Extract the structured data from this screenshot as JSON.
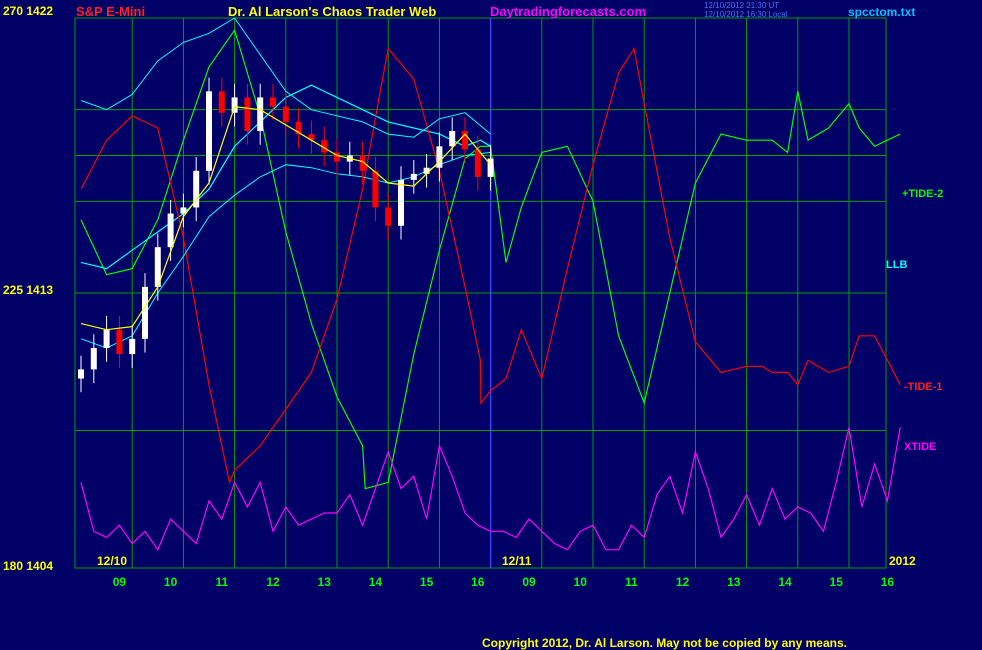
{
  "header": {
    "top_price_label": "270  1422",
    "instrument": "S&P E-Mini",
    "title": "Dr. Al Larson's Chaos Trader Web",
    "site": "Daytradingforecasts.com",
    "timestamp_line1": "12/10/2012 21:30 UT",
    "timestamp_line2": "12/10/2012 16:30 Local",
    "filename": "spcctom.txt"
  },
  "footer": {
    "copyright": "Copyright 2012, Dr. Al Larson. May not be copied by any means."
  },
  "colors": {
    "background": "#000066",
    "grid": "#00a000",
    "divider": "#4040ff",
    "axis_text": "#ffff00",
    "tick_text": "#00ff00",
    "title": "#ffff00",
    "instrument": "#ff2020",
    "site": "#ff00ff",
    "filename": "#00c0ff",
    "tide2": "#00ff00",
    "llb": "#00ffff",
    "tide1": "#ff0000",
    "xtide": "#ff00ff",
    "candle_up": "#ffffff",
    "candle_down": "#ff0000",
    "moving_average": "#ffff00"
  },
  "chart_data": {
    "type": "line",
    "title": "Dr. Al Larson's Chaos Trader Web",
    "y_axis_labels": [
      "270  1422",
      "225  1413",
      "180  1404"
    ],
    "ylim_price": [
      1404,
      1422
    ],
    "ylim_cycle": [
      180,
      270
    ],
    "date_labels": [
      "12/10",
      "12/11",
      "2012"
    ],
    "x_ticks": [
      "09",
      "10",
      "11",
      "12",
      "13",
      "14",
      "15",
      "16",
      "09",
      "10",
      "11",
      "12",
      "13",
      "14",
      "15",
      "16"
    ],
    "x_range": [
      0,
      16
    ],
    "grid": true,
    "legend_placement": "right",
    "price_bars": {
      "label": "S&P E-Mini",
      "x": [
        0.0,
        0.25,
        0.5,
        0.75,
        1.0,
        1.25,
        1.5,
        1.75,
        2.0,
        2.25,
        2.5,
        2.75,
        3.0,
        3.25,
        3.5,
        3.75,
        4.0,
        4.25,
        4.5,
        4.75,
        5.0,
        5.25,
        5.5,
        5.75,
        6.0,
        6.25,
        6.5,
        6.75,
        7.0,
        7.25,
        7.5,
        7.75,
        8.0
      ],
      "close": [
        1410.5,
        1411.2,
        1411.8,
        1411.0,
        1411.5,
        1413.2,
        1414.5,
        1415.6,
        1415.8,
        1417.0,
        1419.6,
        1418.9,
        1419.4,
        1418.3,
        1419.4,
        1419.1,
        1418.6,
        1418.2,
        1418.0,
        1417.6,
        1417.3,
        1417.5,
        1417.0,
        1415.8,
        1415.2,
        1416.7,
        1416.9,
        1417.1,
        1417.8,
        1418.3,
        1417.7,
        1416.8,
        1417.4
      ]
    },
    "moving_average": {
      "x": [
        0,
        0.5,
        1,
        1.5,
        2,
        2.5,
        3,
        3.5,
        4,
        4.5,
        5,
        5.5,
        6,
        6.5,
        7,
        7.5,
        8
      ],
      "y": [
        1412.0,
        1411.8,
        1411.9,
        1413.2,
        1415.5,
        1416.6,
        1419.1,
        1419.0,
        1418.5,
        1418.0,
        1417.5,
        1417.3,
        1416.6,
        1416.5,
        1417.3,
        1418.2,
        1417.2
      ]
    },
    "envelope": {
      "upper_x": [
        0,
        0.5,
        1,
        1.5,
        2,
        2.5,
        3,
        3.5,
        4,
        4.5,
        5,
        5.5,
        6,
        6.5,
        7,
        7.5,
        8
      ],
      "upper_y": [
        1419.3,
        1419.0,
        1419.5,
        1420.6,
        1421.2,
        1421.5,
        1422.0,
        1420.8,
        1419.6,
        1419.0,
        1418.8,
        1418.6,
        1418.2,
        1418.1,
        1418.7,
        1418.9,
        1418.2
      ],
      "lower_x": [
        0,
        0.5,
        1,
        1.5,
        2,
        2.5,
        3,
        3.5,
        4,
        4.5,
        5,
        5.5,
        6,
        6.5,
        7,
        7.5,
        8
      ],
      "lower_y": [
        1411.5,
        1411.2,
        1411.6,
        1413.0,
        1414.2,
        1415.5,
        1416.2,
        1416.8,
        1417.2,
        1417.1,
        1416.9,
        1416.8,
        1416.6,
        1416.8,
        1417.2,
        1417.5,
        1417.6
      ]
    },
    "series": [
      {
        "name": "+TIDE-2",
        "x": [
          0,
          0.5,
          1,
          1.5,
          2,
          2.5,
          3,
          3.5,
          4,
          4.5,
          5,
          5.5,
          5.55,
          6,
          6.5,
          7,
          7.5,
          7.8,
          8,
          8.3,
          8.6,
          9,
          9.5,
          10,
          10.5,
          11,
          11.5,
          12,
          12.5,
          13,
          13.5,
          13.8,
          14,
          14.2,
          14.6,
          15,
          15.2,
          15.5,
          16
        ],
        "y": [
          237,
          228,
          229,
          237,
          250,
          262,
          268,
          254,
          235,
          220,
          208,
          200,
          193,
          194,
          215,
          232,
          247,
          249,
          249,
          230,
          239,
          248,
          249,
          240,
          218,
          207,
          225,
          243,
          251,
          250,
          250,
          248,
          258,
          250,
          252,
          256,
          252,
          249,
          251
        ]
      },
      {
        "name": "LLB",
        "x": [
          0,
          0.5,
          1,
          1.5,
          2,
          2.5,
          3,
          3.5,
          4,
          4.5,
          5,
          5.5,
          6,
          6.5,
          7,
          7.5,
          7.8,
          8
        ],
        "y": [
          230,
          229,
          232,
          235,
          238,
          242,
          249,
          253,
          257,
          259,
          257,
          255,
          253,
          252,
          251,
          249,
          250,
          249
        ]
      },
      {
        "name": "-TIDE-1",
        "x": [
          0,
          0.5,
          1,
          1.5,
          2,
          2.5,
          2.9,
          3.0,
          3.5,
          4,
          4.5,
          5,
          5.5,
          5.8,
          6,
          6.5,
          7,
          7.5,
          7.8,
          7.81,
          8,
          8.3,
          8.6,
          9,
          9.5,
          10,
          10.5,
          10.8,
          11,
          11.5,
          12,
          12.5,
          13,
          13.3,
          13.5,
          13.8,
          14,
          14.2,
          14.6,
          15,
          15.2,
          15.5,
          16
        ],
        "y": [
          242,
          250,
          254,
          252,
          234,
          210,
          194,
          196,
          200,
          206,
          212,
          224,
          242,
          256,
          265,
          260,
          245,
          226,
          214,
          207,
          209,
          211,
          219,
          211,
          229,
          246,
          261,
          265,
          256,
          234,
          217,
          212,
          213,
          213,
          212,
          212,
          210,
          214,
          212,
          213,
          218,
          218,
          210
        ]
      },
      {
        "name": "XTIDE",
        "x": [
          0,
          0.25,
          0.5,
          0.75,
          1,
          1.25,
          1.5,
          1.75,
          2,
          2.25,
          2.5,
          2.75,
          3,
          3.25,
          3.5,
          3.75,
          4,
          4.25,
          4.5,
          4.75,
          5,
          5.25,
          5.5,
          5.75,
          6,
          6.25,
          6.5,
          6.75,
          7,
          7.25,
          7.5,
          7.75,
          8,
          8.25,
          8.5,
          8.75,
          9,
          9.25,
          9.5,
          9.75,
          10,
          10.25,
          10.5,
          10.75,
          11,
          11.25,
          11.5,
          11.75,
          12,
          12.25,
          12.5,
          12.75,
          13,
          13.25,
          13.5,
          13.75,
          14,
          14.25,
          14.5,
          14.75,
          15,
          15.25,
          15.5,
          15.75,
          16
        ],
        "y": [
          194,
          186,
          185,
          187,
          184,
          186,
          183,
          188,
          186,
          184,
          191,
          188,
          194,
          190,
          194,
          186,
          190,
          187,
          188,
          189,
          189,
          192,
          187,
          193,
          199,
          193,
          195,
          188,
          200,
          195,
          189,
          187,
          186,
          186,
          185,
          188,
          186,
          184,
          183,
          186,
          187,
          183,
          183,
          187,
          185,
          192,
          195,
          189,
          199,
          193,
          185,
          188,
          192,
          187,
          193,
          188,
          190,
          189,
          186,
          194,
          203,
          190,
          197,
          191,
          203
        ]
      }
    ]
  },
  "legend": {
    "tide2": "+TIDE-2",
    "llb": "LLB",
    "tide1": "-TIDE-1",
    "xtide": "XTIDE"
  }
}
